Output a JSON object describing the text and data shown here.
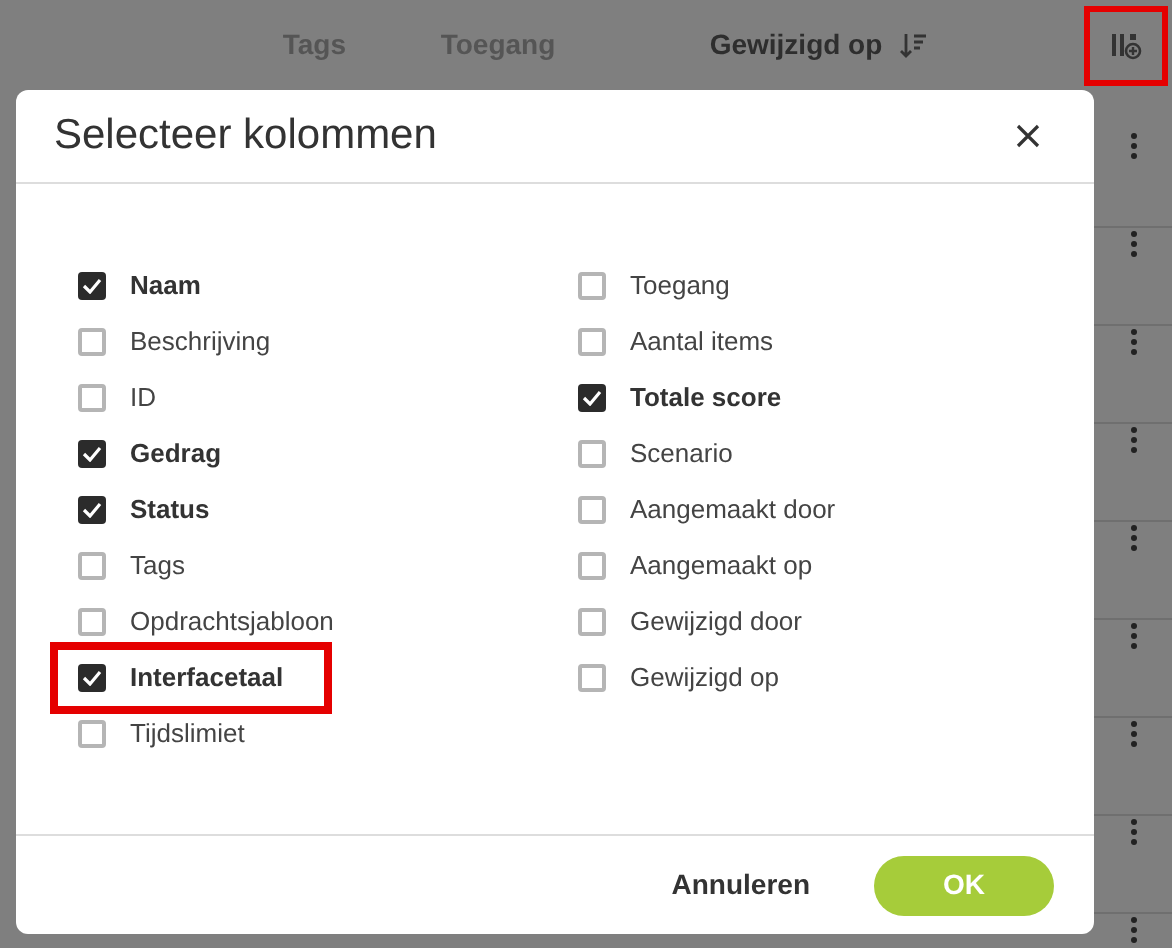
{
  "table_header": {
    "columns": [
      {
        "label": "Tags",
        "sorted": false
      },
      {
        "label": "Toegang",
        "sorted": false
      },
      {
        "label": "Gewijzigd op",
        "sorted": true
      }
    ],
    "column_settings": {
      "highlighted": true
    }
  },
  "dialog": {
    "title": "Selecteer kolommen",
    "columns": [
      [
        {
          "label": "Naam",
          "checked": true,
          "highlighted": false
        },
        {
          "label": "Beschrijving",
          "checked": false,
          "highlighted": false
        },
        {
          "label": "ID",
          "checked": false,
          "highlighted": false
        },
        {
          "label": "Gedrag",
          "checked": true,
          "highlighted": false
        },
        {
          "label": "Status",
          "checked": true,
          "highlighted": false
        },
        {
          "label": "Tags",
          "checked": false,
          "highlighted": false
        },
        {
          "label": "Opdrachtsjabloon",
          "checked": false,
          "highlighted": false
        },
        {
          "label": "Interfacetaal",
          "checked": true,
          "highlighted": true
        },
        {
          "label": "Tijdslimiet",
          "checked": false,
          "highlighted": false
        }
      ],
      [
        {
          "label": "Toegang",
          "checked": false,
          "highlighted": false
        },
        {
          "label": "Aantal items",
          "checked": false,
          "highlighted": false
        },
        {
          "label": "Totale score",
          "checked": true,
          "highlighted": false
        },
        {
          "label": "Scenario",
          "checked": false,
          "highlighted": false
        },
        {
          "label": "Aangemaakt door",
          "checked": false,
          "highlighted": false
        },
        {
          "label": "Aangemaakt op",
          "checked": false,
          "highlighted": false
        },
        {
          "label": "Gewijzigd door",
          "checked": false,
          "highlighted": false
        },
        {
          "label": "Gewijzigd op",
          "checked": false,
          "highlighted": false
        }
      ]
    ],
    "buttons": {
      "cancel": "Annuleren",
      "ok": "OK"
    }
  }
}
